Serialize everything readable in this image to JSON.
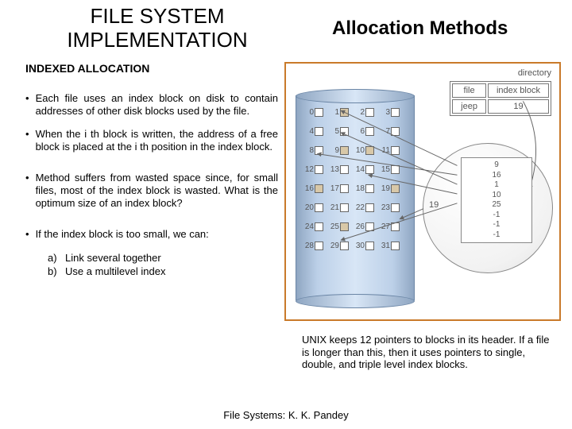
{
  "title_main_line1": "FILE SYSTEM",
  "title_main_line2": "IMPLEMENTATION",
  "title_right": "Allocation Methods",
  "subheading": "INDEXED ALLOCATION",
  "bullets": [
    "Each file uses an index block on disk to contain addresses of other disk blocks used by the file.",
    "When the i th block is written, the address of a free block is placed at the i th position in the index block.",
    "Method suffers from wasted space since, for small files, most of the index block is wasted. What is the optimum size of an index block?",
    "If the index block is too small, we can:"
  ],
  "subitems": [
    {
      "label": "a)",
      "text": "Link several together"
    },
    {
      "label": "b)",
      "text": "Use a multilevel index"
    }
  ],
  "diagram": {
    "directory_label": "directory",
    "dir_headers": [
      "file",
      "index block"
    ],
    "dir_row": [
      "jeep",
      "19"
    ],
    "index_head": "19",
    "index_values": [
      "9",
      "16",
      "1",
      "10",
      "25",
      "-1",
      "-1",
      "-1"
    ],
    "highlighted_cells": [
      1,
      9,
      10,
      16,
      19,
      25
    ],
    "num_rows": 8,
    "cols_per_row": 4
  },
  "unix_text": "UNIX keeps 12 pointers to blocks in its header. If a file is longer than this, then it uses pointers to single, double, and triple level index blocks.",
  "footer": "File Systems: K. K. Pandey"
}
